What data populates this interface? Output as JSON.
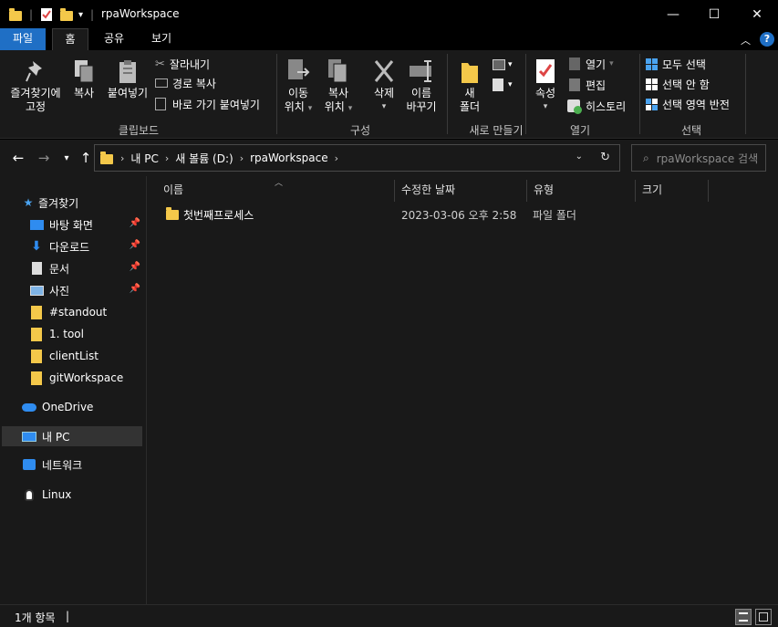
{
  "window": {
    "title": "rpaWorkspace",
    "minimize_glyph": "—",
    "maximize_glyph": "☐",
    "close_glyph": "✕"
  },
  "ribbon_tabs": [
    {
      "label": "파일"
    },
    {
      "label": "홈"
    },
    {
      "label": "공유"
    },
    {
      "label": "보기"
    }
  ],
  "ribbon": {
    "clipboard": {
      "pin_label_1": "즐겨찾기에",
      "pin_label_2": "고정",
      "copy": "복사",
      "paste": "붙여넣기",
      "cut": "잘라내기",
      "copy_path": "경로 복사",
      "paste_shortcut": "바로 가기 붙여넣기",
      "group": "클립보드"
    },
    "organize": {
      "move_1": "이동",
      "move_2": "위치",
      "copy_1": "복사",
      "copy_2": "위치",
      "delete": "삭제",
      "rename_1": "이름",
      "rename_2": "바꾸기",
      "group": "구성"
    },
    "new": {
      "new_folder_1": "새",
      "new_folder_2": "폴더",
      "group": "새로 만들기"
    },
    "open": {
      "properties": "속성",
      "open": "열기",
      "edit": "편집",
      "history": "히스토리",
      "group": "열기"
    },
    "select": {
      "select_all": "모두 선택",
      "select_none": "선택 안 함",
      "invert": "선택 영역 반전",
      "group": "선택"
    }
  },
  "address": {
    "crumbs": [
      "내 PC",
      "새 볼륨 (D:)",
      "rpaWorkspace"
    ],
    "search_placeholder": "rpaWorkspace 검색"
  },
  "nav": {
    "items": [
      {
        "label": "즐겨찾기"
      },
      {
        "label": "바탕 화면"
      },
      {
        "label": "다운로드"
      },
      {
        "label": "문서"
      },
      {
        "label": "사진"
      },
      {
        "label": "#standout"
      },
      {
        "label": "1. tool"
      },
      {
        "label": "clientList"
      },
      {
        "label": "gitWorkspace"
      },
      {
        "label": "OneDrive"
      },
      {
        "label": "내 PC"
      },
      {
        "label": "네트워크"
      },
      {
        "label": "Linux"
      }
    ]
  },
  "columns": [
    "이름",
    "수정한 날짜",
    "유형",
    "크기"
  ],
  "files": [
    {
      "name": "첫번째프로세스",
      "modified": "2023-03-06 오후 2:58",
      "type": "파일 폴더",
      "size": ""
    }
  ],
  "status": {
    "count": "1개 항목",
    "separator": "|"
  },
  "colors": {
    "accent": "#1f6fc5",
    "folder": "#f4c84a",
    "background": "#191919"
  }
}
